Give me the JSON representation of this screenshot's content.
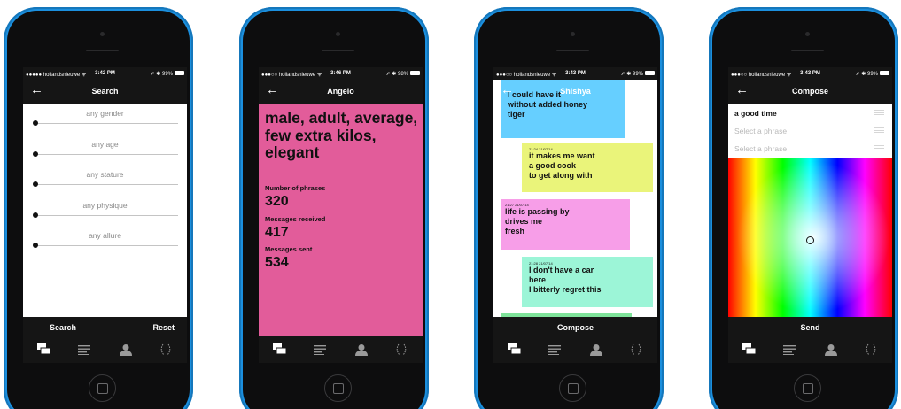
{
  "colors": {
    "phone_body": "#1b8fde",
    "screen_bg": "#151515",
    "profile_bg": "#e25c9a"
  },
  "phones": [
    {
      "status": {
        "carrier": "●●●●● hollandsnieuwe ᯤ",
        "time": "3:42 PM",
        "right": "➚ ✱ 99%"
      },
      "nav": {
        "back_icon": "back-arrow-icon",
        "title": "Search"
      },
      "filters": [
        {
          "label": "any gender",
          "level": 0
        },
        {
          "label": "any age",
          "level": 0
        },
        {
          "label": "any stature",
          "level": 0
        },
        {
          "label": "any physique",
          "level": 0
        },
        {
          "label": "any allure",
          "level": 0
        }
      ],
      "actions": {
        "search": "Search",
        "reset": "Reset"
      },
      "tabs": [
        "chat-bubbles-icon",
        "list-icon",
        "person-icon",
        "laurel-icon"
      ]
    },
    {
      "status": {
        "carrier": "●●●○○ hollandsnieuwe ᯤ",
        "time": "3:46 PM",
        "right": "➚ ✱ 98%"
      },
      "nav": {
        "back_icon": "back-arrow-icon",
        "title": "Angelo"
      },
      "profile": {
        "headline": "male, adult, average, few extra kilos, elegant",
        "phrases_label": "Number of phrases",
        "phrases_value": "320",
        "received_label": "Messages received",
        "received_value": "417",
        "sent_label": "Messages sent",
        "sent_value": "534"
      },
      "tabs": [
        "chat-bubbles-icon",
        "list-icon",
        "person-icon",
        "laurel-icon"
      ]
    },
    {
      "status": {
        "carrier": "●●●○○ hollandsnieuwe ᯤ",
        "time": "3:43 PM",
        "right": "➚ ✱ 99%"
      },
      "nav": {
        "back_icon": "back-arrow-icon",
        "title": "Shishya"
      },
      "messages": [
        {
          "stamp": "",
          "text": "I could have it\nwithout added honey\ntiger",
          "color": "#66cfff"
        },
        {
          "stamp": "21:24 21/07/14",
          "text": "it makes me want\na good cook\nto get along with",
          "color": "#eaf47a"
        },
        {
          "stamp": "21:27 21/07/14",
          "text": "life is passing by\ndrives me\nfresh",
          "color": "#f79ee8"
        },
        {
          "stamp": "21:28 21/07/14",
          "text": "I don't have a car\nhere\nI bitterly regret this",
          "color": "#9cf5d7"
        }
      ],
      "action": "Compose",
      "tabs": [
        "chat-bubbles-icon",
        "list-icon",
        "person-icon",
        "laurel-icon"
      ]
    },
    {
      "status": {
        "carrier": "●●●○○ hollandsnieuwe ᯤ",
        "time": "3:43 PM",
        "right": "➚ ✱ 99%"
      },
      "nav": {
        "back_icon": "back-arrow-icon",
        "title": "Compose"
      },
      "phrases": [
        {
          "text": "a good time",
          "filled": true
        },
        {
          "text": "Select a phrase",
          "filled": false
        },
        {
          "text": "Select a phrase",
          "filled": false
        }
      ],
      "action": "Send",
      "tabs": [
        "chat-bubbles-icon",
        "list-icon",
        "person-icon",
        "laurel-icon"
      ]
    }
  ]
}
